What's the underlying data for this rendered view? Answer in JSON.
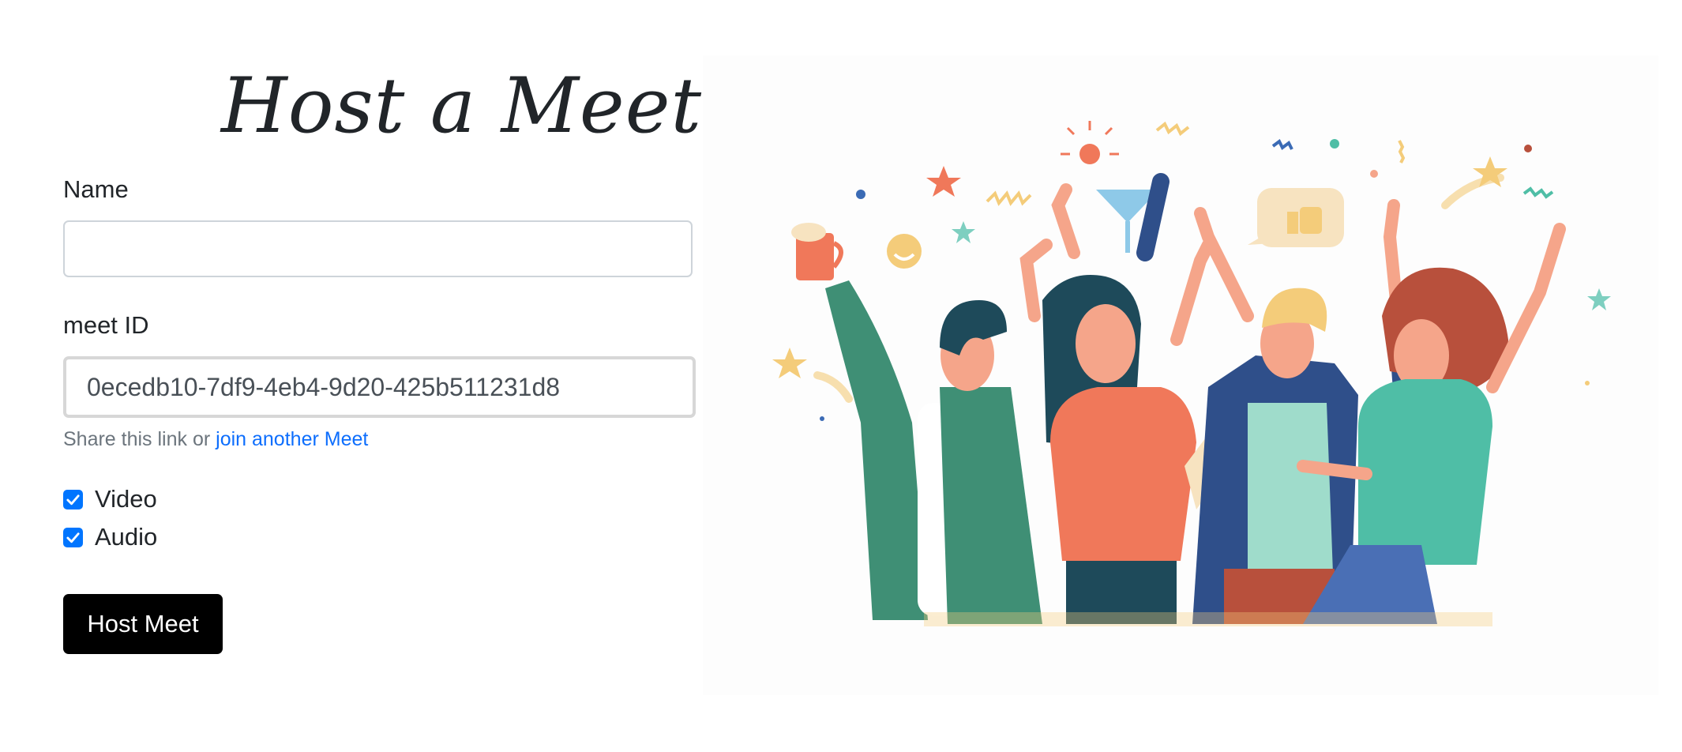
{
  "page": {
    "title": "Host a Meet"
  },
  "form": {
    "name_label": "Name",
    "name_value": "",
    "meet_id_label": "meet ID",
    "meet_id_value": "0ecedb10-7df9-4eb4-9d20-425b511231d8",
    "help_prefix": "Share this link or ",
    "help_link": "join another Meet",
    "video_label": "Video",
    "video_checked": true,
    "audio_label": "Audio",
    "audio_checked": true,
    "submit_label": "Host Meet"
  },
  "colors": {
    "accent": "#0075ff",
    "link": "#0d6efd",
    "button": "#000000",
    "illustration_palette": [
      "#f0785a",
      "#3f8f75",
      "#1e4a5a",
      "#f5a58a",
      "#4fbea6",
      "#2f4f8a",
      "#f4cc7a",
      "#b8503c"
    ]
  },
  "illustration": {
    "icon": "party-people-illustration"
  }
}
